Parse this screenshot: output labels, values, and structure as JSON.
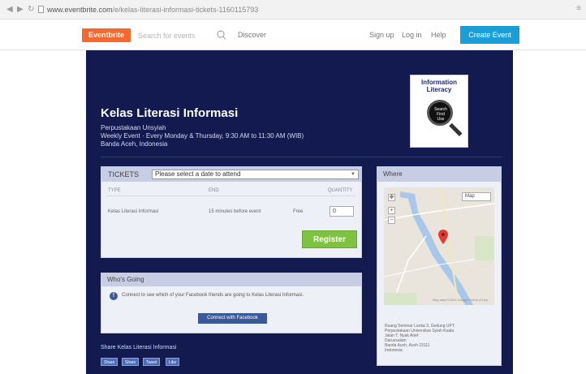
{
  "browser": {
    "url_host": "www.eventbrite.com",
    "url_rest": "/e/kelas-literasi-informasi-tickets-1160115793",
    "menu": "≡"
  },
  "header": {
    "logo": "Eventbrite",
    "search_placeholder": "Search for events",
    "discover": "Discover",
    "sign_up": "Sign up",
    "log_in": "Log in",
    "help": "Help",
    "create_event": "Create Event"
  },
  "thumbnail": {
    "title_line1": "Information",
    "title_line2": "Literacy",
    "lens_text": "Search Find Use"
  },
  "event": {
    "title": "Kelas Literasi Informasi",
    "organizer": "Perpustakaan Unsyiah",
    "schedule": "Weekly Event · Every Monday & Thursday, 9:30 AM to 11:30 AM (WIB)",
    "location": "Banda Aceh, Indonesia"
  },
  "tickets": {
    "label": "TICKETS",
    "date_select": "Please select a date to attend",
    "col_type": "TYPE",
    "col_end": "END",
    "col_qty": "QUANTITY",
    "row_type": "Kelas Literasi Informasi",
    "row_end": "15 minutes before event",
    "row_price": "Free",
    "row_qty": "0",
    "register": "Register"
  },
  "going": {
    "header": "Who's Going",
    "text": "Connect to see which of your Facebook friends are going to Kelas Literasi Informasi.",
    "fb_button": "Connect with Facebook"
  },
  "share": {
    "label": "Share Kelas Literasi Informasi",
    "buttons": [
      "Share",
      "Share",
      "Tweet",
      "Like"
    ]
  },
  "where": {
    "header": "Where",
    "map_type": "Map",
    "map_footer": "Map data ©2015 Google  Terms of Use",
    "address_lines": [
      "Ruang Seminar Lantai 3, Gedung UPT.",
      "Perpustakaan Universitas Syiah Kuala",
      "Jalan T. Nyak Arief",
      "Darussalam",
      "Banda Aceh, Aceh 23111",
      "Indonesia"
    ]
  },
  "colors": {
    "panel": "#131a50",
    "logo": "#f6682f",
    "create": "#1a9ed8",
    "register": "#7fc242",
    "facebook": "#3b5998"
  }
}
